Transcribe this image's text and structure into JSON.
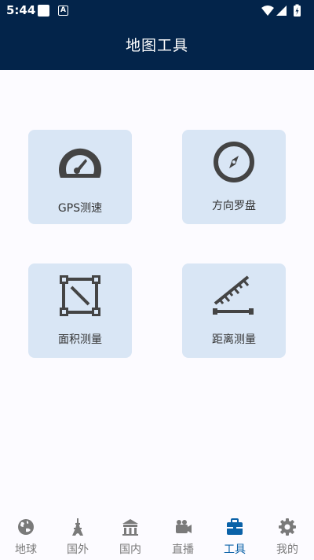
{
  "status_bar": {
    "time": "5:44",
    "a_badge": "A"
  },
  "header": {
    "title": "地图工具"
  },
  "tools": [
    {
      "label": "GPS测速",
      "icon": "speedometer-icon"
    },
    {
      "label": "方向罗盘",
      "icon": "compass-icon"
    },
    {
      "label": "面积测量",
      "icon": "area-measure-icon"
    },
    {
      "label": "距离测量",
      "icon": "ruler-icon"
    }
  ],
  "nav": [
    {
      "label": "地球",
      "icon": "globe-icon",
      "active": false
    },
    {
      "label": "国外",
      "icon": "eiffel-tower-icon",
      "active": false
    },
    {
      "label": "国内",
      "icon": "pavilion-icon",
      "active": false
    },
    {
      "label": "直播",
      "icon": "video-camera-icon",
      "active": false
    },
    {
      "label": "工具",
      "icon": "toolbox-icon",
      "active": true
    },
    {
      "label": "我的",
      "icon": "gear-icon",
      "active": false
    }
  ],
  "colors": {
    "header_bg": "#03244a",
    "tile_bg": "#d9e6f5",
    "active": "#0a62a8",
    "inactive": "#7a7a7a"
  }
}
